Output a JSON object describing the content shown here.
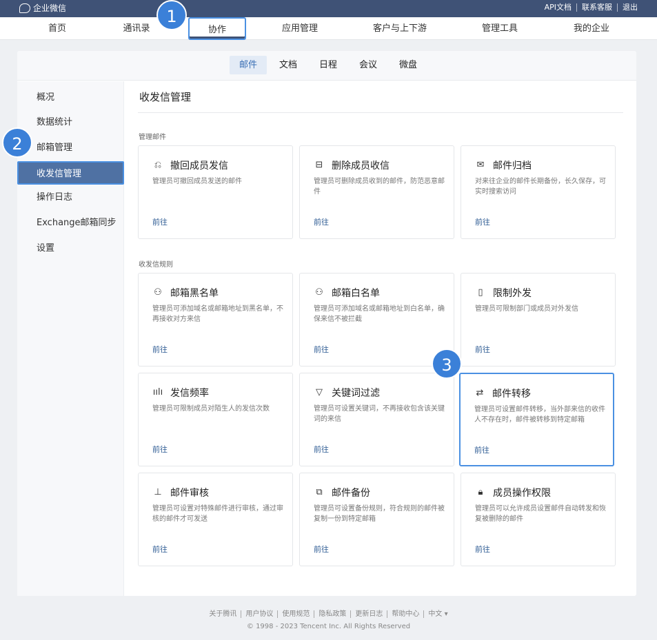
{
  "topbar": {
    "logo": "企业微信",
    "links": [
      "API文档",
      "联系客服",
      "退出"
    ]
  },
  "nav": {
    "items": [
      "首页",
      "通讯录",
      "协作",
      "应用管理",
      "客户与上下游",
      "管理工具",
      "我的企业"
    ],
    "active": "协作"
  },
  "subnav": {
    "items": [
      "邮件",
      "文档",
      "日程",
      "会议",
      "微盘"
    ],
    "active": "邮件"
  },
  "sidebar": {
    "items": [
      "概况",
      "数据统计",
      "邮箱管理",
      "收发信管理",
      "操作日志",
      "Exchange邮箱同步",
      "设置"
    ],
    "active": "收发信管理"
  },
  "page": {
    "title": "收发信管理",
    "section1": "管理邮件",
    "section2": "收发信规则"
  },
  "cards": [
    {
      "title": "撤回成员发信",
      "desc": "管理员可撤回成员发送的邮件",
      "link": "前往",
      "icon": "undo-mail-icon"
    },
    {
      "title": "删除成员收信",
      "desc": "管理员可删除成员收到的邮件，防范恶意邮件",
      "link": "前往",
      "icon": "delete-mail-icon"
    },
    {
      "title": "邮件归档",
      "desc": "对来往企业的邮件长期备份，长久保存，可实时搜索访问",
      "link": "前往",
      "icon": "mail-icon"
    },
    {
      "title": "邮箱黑名单",
      "desc": "管理员可添加域名或邮箱地址到黑名单，不再接收对方来信",
      "link": "前往",
      "icon": "user-block-icon"
    },
    {
      "title": "邮箱白名单",
      "desc": "管理员可添加域名或邮箱地址到白名单，确保来信不被拦截",
      "link": "前往",
      "icon": "user-check-icon"
    },
    {
      "title": "限制外发",
      "desc": "管理员可限制部门或成员对外发信",
      "link": "前往",
      "icon": "door-icon"
    },
    {
      "title": "发信频率",
      "desc": "管理员可限制成员对陌生人的发信次数",
      "link": "前往",
      "icon": "frequency-icon"
    },
    {
      "title": "关键词过滤",
      "desc": "管理员可设置关键词，不再接收包含该关键词的来信",
      "link": "前往",
      "icon": "filter-icon"
    },
    {
      "title": "邮件转移",
      "desc": "管理员可设置邮件转移，当外部来信的收件人不存在时，邮件被转移到特定邮箱",
      "link": "前往",
      "icon": "transfer-icon"
    },
    {
      "title": "邮件审核",
      "desc": "管理员可设置对特殊邮件进行审核，通过审核的邮件才可发送",
      "link": "前往",
      "icon": "stamp-icon"
    },
    {
      "title": "邮件备份",
      "desc": "管理员可设置备份规则，符合规则的邮件被复制一份到特定邮箱",
      "link": "前往",
      "icon": "backup-icon"
    },
    {
      "title": "成员操作权限",
      "desc": "管理员可以允许成员设置邮件自动转发和恢复被删除的邮件",
      "link": "前往",
      "icon": "lock-icon"
    }
  ],
  "badges": [
    "1",
    "2",
    "3"
  ],
  "footer": {
    "links": [
      "关于腾讯",
      "用户协议",
      "使用规范",
      "隐私政策",
      "更新日志",
      "帮助中心",
      "中文 ▾"
    ],
    "copyright": "© 1998 - 2023 Tencent Inc. All Rights Reserved"
  }
}
